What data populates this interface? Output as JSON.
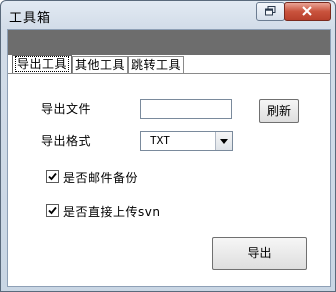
{
  "window": {
    "title": "工具箱"
  },
  "tabs": [
    {
      "label": "导出工具",
      "active": true
    },
    {
      "label": "其他工具",
      "active": false
    },
    {
      "label": "跳转工具",
      "active": false
    }
  ],
  "export_panel": {
    "file_label": "导出文件",
    "file_value": "",
    "refresh_button": "刷新",
    "format_label": "导出格式",
    "format_value": "TXT",
    "mail_backup_label": "是否邮件备份",
    "mail_backup_checked": true,
    "upload_svn_label": "是否直接上传svn",
    "upload_svn_checked": true,
    "export_button": "导出"
  },
  "colors": {
    "close_button": "#c9533d",
    "band": "#6d6d6d",
    "title_gradient_top": "#e2eaf3"
  },
  "icons": [
    "restore-icon",
    "close-icon",
    "dropdown-arrow-icon",
    "checkmark-icon"
  ]
}
